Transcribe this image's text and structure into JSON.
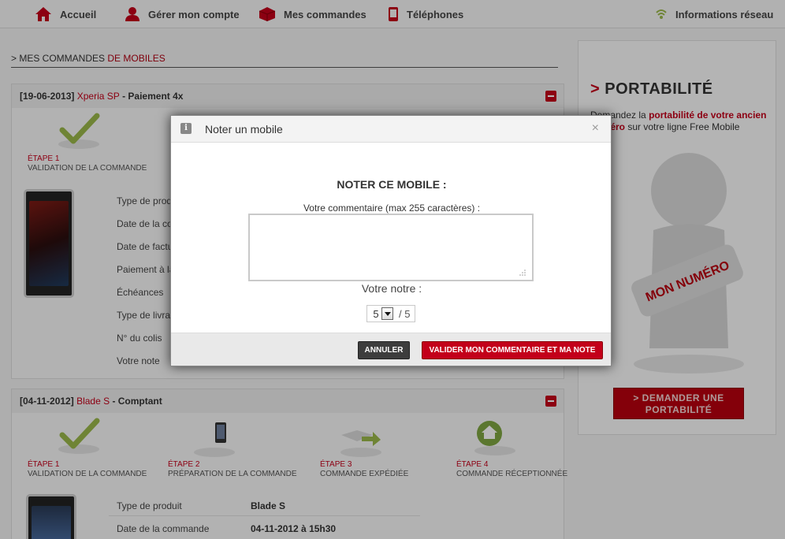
{
  "nav": {
    "items": [
      {
        "label": "Accueil",
        "icon": "home-icon"
      },
      {
        "label": "Gérer mon compte",
        "icon": "user-icon"
      },
      {
        "label": "Mes commandes",
        "icon": "box-icon"
      },
      {
        "label": "Téléphones",
        "icon": "phone-icon"
      }
    ],
    "network": {
      "label": "Informations réseau",
      "icon": "signal-icon"
    }
  },
  "breadcrumb": {
    "prefix": "> MES COMMANDES",
    "highlight": "DE MOBILES"
  },
  "orders": [
    {
      "date": "[19-06-2013]",
      "phone": "Xperia SP",
      "payment": "- Paiement 4x",
      "steps": [
        {
          "num": "ÉTAPE 1",
          "label": "VALIDATION DE LA COMMANDE"
        }
      ],
      "details": [
        {
          "label": "Type de produit"
        },
        {
          "label": "Date de la commande"
        },
        {
          "label": "Date de facturation"
        },
        {
          "label": "Paiement à la livraison"
        },
        {
          "label": "Échéances"
        },
        {
          "label": "Type de livraison"
        },
        {
          "label": "N° du colis"
        },
        {
          "label": "Votre note"
        }
      ]
    },
    {
      "date": "[04-11-2012]",
      "phone": "Blade S",
      "payment": "- Comptant",
      "steps": [
        {
          "num": "ÉTAPE 1",
          "label": "VALIDATION DE LA COMMANDE"
        },
        {
          "num": "ÉTAPE 2",
          "label": "PRÉPARATION DE LA COMMANDE"
        },
        {
          "num": "ÉTAPE 3",
          "label": "COMMANDE EXPÉDIÉE"
        },
        {
          "num": "ÉTAPE 4",
          "label": "COMMANDE RÉCEPTIONNÉE"
        }
      ],
      "details": [
        {
          "label": "Type de produit",
          "value": "Blade S"
        },
        {
          "label": "Date de la commande",
          "value": "04-11-2012 à 15h30"
        }
      ]
    }
  ],
  "sidebar": {
    "title_prefix": ">",
    "title": "PORTABILITÉ",
    "text_start": "Demandez la",
    "text_bold": "portabilité de votre ancien numéro",
    "text_end": "sur votre ligne Free Mobile",
    "mascot_label": "MON NUMÉRO",
    "button_line1": "> DEMANDER UNE",
    "button_line2": "PORTABILITÉ"
  },
  "modal": {
    "title": "Noter un mobile",
    "close": "×",
    "heading": "NOTER CE MOBILE :",
    "comment_label": "Votre commentaire (max 255 caractères) :",
    "comment_value": "",
    "note_label": "Votre notre :",
    "note_value": "5",
    "note_max": "/ 5",
    "cancel_label": "ANNULER",
    "submit_label": "VALIDER MON COMMENTAIRE ET MA NOTE"
  },
  "colors": {
    "accent": "#c3001a",
    "dark_button": "#3d3d3d"
  }
}
